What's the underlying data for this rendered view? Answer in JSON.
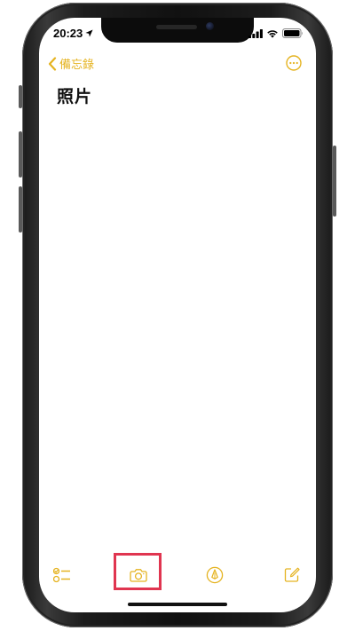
{
  "status_bar": {
    "time": "20:23",
    "icons": [
      "location-arrow-icon",
      "cellular-signal-icon",
      "wifi-icon",
      "battery-icon"
    ]
  },
  "nav": {
    "back_label": "備忘錄",
    "back_icon": "chevron-left-icon",
    "more_icon": "ellipsis-circle-icon"
  },
  "note": {
    "title": "照片"
  },
  "toolbar": {
    "items": [
      {
        "icon": "checklist-icon"
      },
      {
        "icon": "camera-icon",
        "highlighted": true
      },
      {
        "icon": "markup-pen-icon"
      },
      {
        "icon": "compose-icon"
      }
    ]
  },
  "colors": {
    "accent": "#e5b320",
    "highlight": "#e03550",
    "text": "#111111",
    "frame": "#1c1c1c"
  }
}
